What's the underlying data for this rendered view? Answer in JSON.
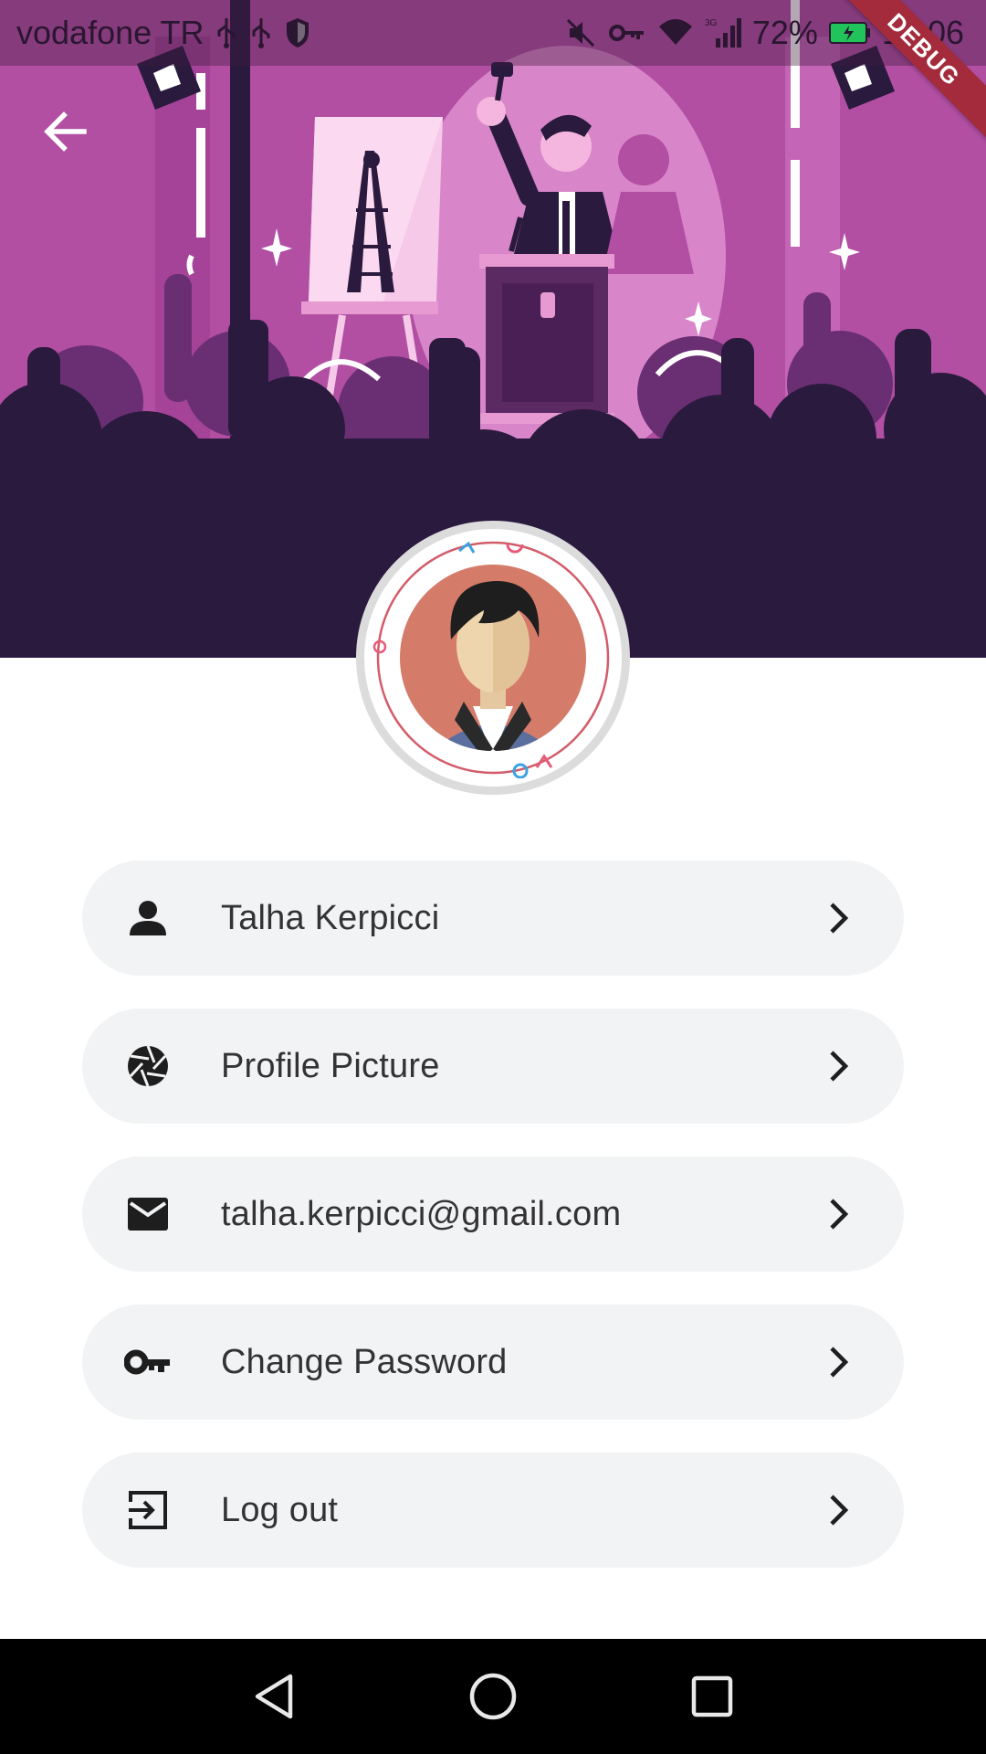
{
  "status_bar": {
    "carrier": "vodafone TR",
    "battery": "72%",
    "time": "19:06",
    "network_type": "3G",
    "icons": [
      "usb-icon",
      "usb-icon",
      "shield-icon",
      "mute-icon",
      "vpn-key-icon",
      "wifi-icon",
      "signal-icon",
      "battery-charging-icon"
    ]
  },
  "debug_banner": {
    "label": "DEBUG"
  },
  "header": {
    "back_icon": "arrow-back-icon"
  },
  "colors": {
    "illustration_bg": "#b24fa3",
    "crowd_dark": "#2a1a3e",
    "menu_bg": "#f2f3f5",
    "avatar_bg": "#d47b6a",
    "debug_red": "#a32b3c"
  },
  "menu": {
    "items": [
      {
        "label": "Talha Kerpicci",
        "icon": "person-icon"
      },
      {
        "label": "Profile Picture",
        "icon": "camera-shutter-icon"
      },
      {
        "label": "talha.kerpicci@gmail.com",
        "icon": "mail-icon"
      },
      {
        "label": "Change Password",
        "icon": "key-icon"
      },
      {
        "label": "Log out",
        "icon": "exit-icon"
      }
    ]
  },
  "nav_bar": {
    "buttons": [
      "back-triangle-icon",
      "home-circle-icon",
      "recents-square-icon"
    ]
  }
}
